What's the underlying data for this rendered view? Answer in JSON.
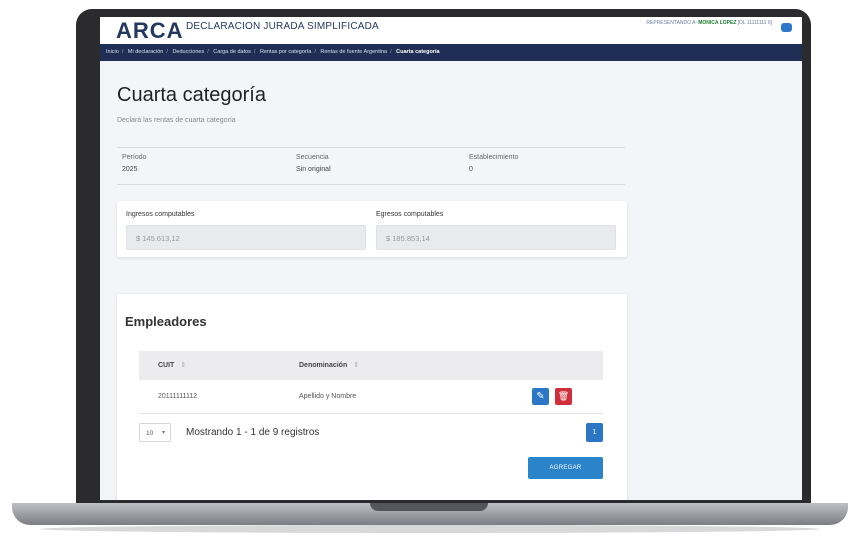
{
  "header": {
    "logo": "ARCA",
    "app_title": "DECLARACION JURADA SIMPLIFICADA",
    "user_line1": "",
    "user_prefix": "REPRESENTANDO A:",
    "user_name": "MONICA LOPEZ",
    "user_id": "[DL 11111111 6]"
  },
  "breadcrumb": [
    "Inicio",
    "Mi declaración",
    "Deducciones",
    "Carga de datos",
    "Rentas por categoría",
    "Rentas de fuente Argentina",
    "Cuarta categoría"
  ],
  "page": {
    "title": "Cuarta categoría",
    "subtitle": "Declará las rentas de cuarta categoría"
  },
  "info": {
    "periodo_label": "Período",
    "periodo_value": "2025",
    "secuencia_label": "Secuencia",
    "secuencia_value": "Sin original",
    "establecimiento_label": "Establecimiento",
    "establecimiento_value": "0"
  },
  "totals": {
    "ingresos_label": "Ingresos computables",
    "ingresos_value": "$ 145.613,12",
    "egresos_label": "Egresos computables",
    "egresos_value": "$ 185.853,14"
  },
  "empleadores": {
    "title": "Empleadores",
    "columns": [
      "CUIT",
      "Denominación"
    ],
    "rows": [
      {
        "cuit": "20111111112",
        "denominacion": "Apellido y Nombre"
      }
    ],
    "page_size": "10",
    "paging_text": "Mostrando 1 - 1 de 9 registros",
    "current_page": "1",
    "add_label": "AGREGAR"
  },
  "icons": {
    "edit": "pencil-icon",
    "delete": "trash-icon",
    "sort": "sort-icon",
    "user": "user-icon"
  },
  "colors": {
    "navbar": "#1f2e55",
    "primary": "#2b77c6",
    "danger": "#cf2f3a",
    "brand": "#24395f"
  }
}
